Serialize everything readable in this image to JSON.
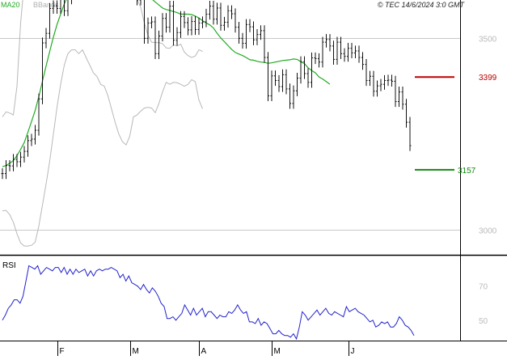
{
  "header": {
    "legend_ma20": "MA20",
    "legend_bbands": "BBands",
    "copyright": "© TEC 14/6/2024 3:0 GMT"
  },
  "colors": {
    "ma20": "#22aa22",
    "bbands": "#b8b8b8",
    "price": "#111111",
    "rsi": "#2222cc",
    "resistance": "#bb0000",
    "support": "#118811",
    "grid": "#c8c8c8"
  },
  "chart_data": [
    {
      "type": "line",
      "name": "price-panel",
      "title": "",
      "ylim": [
        2935,
        3600
      ],
      "y_ticks": [
        {
          "value": 3500,
          "label": "3500"
        },
        {
          "value": 3000,
          "label": "3000"
        }
      ],
      "grid": true,
      "resistance": {
        "value": 3399,
        "label": "3399"
      },
      "support": {
        "value": 3157,
        "label": "3157"
      },
      "ohlc_close": [
        3147,
        3168,
        3167,
        3184,
        3178,
        3190,
        3205,
        3233,
        3237,
        3260,
        3342,
        3488,
        3513,
        3578,
        3585,
        3578,
        3601,
        3572,
        3603,
        3614,
        3648,
        3677,
        3690,
        3690,
        3684,
        3720,
        3670,
        3699,
        3688,
        3660,
        3699,
        3700,
        3670,
        3630,
        3677,
        3646,
        3655,
        3600,
        3630,
        3500,
        3540,
        3543,
        3460,
        3506,
        3552,
        3529,
        3584,
        3495,
        3515,
        3557,
        3541,
        3522,
        3544,
        3523,
        3540,
        3543,
        3563,
        3584,
        3550,
        3579,
        3534,
        3542,
        3572,
        3564,
        3529,
        3500,
        3487,
        3536,
        3530,
        3496,
        3510,
        3520,
        3450,
        3350,
        3402,
        3390,
        3374,
        3405,
        3368,
        3330,
        3363,
        3396,
        3439,
        3408,
        3385,
        3449,
        3447,
        3438,
        3490,
        3497,
        3480,
        3445,
        3490,
        3460,
        3453,
        3474,
        3462,
        3467,
        3450,
        3432,
        3390,
        3401,
        3362,
        3376,
        3380,
        3390,
        3391,
        3388,
        3335,
        3360,
        3328,
        3281,
        3220
      ],
      "ma20": [
        3165,
        3168,
        3174,
        3181,
        3194,
        3210,
        3228,
        3255,
        3283,
        3312,
        3348,
        3388,
        3428,
        3466,
        3503,
        3536,
        3563,
        3590,
        3610,
        3627,
        3643,
        3657,
        3670,
        3679,
        3687,
        3693,
        3699,
        3700,
        3698,
        3696,
        3689,
        3683,
        3676,
        3671,
        3665,
        3660,
        3654,
        3645,
        3635,
        3625,
        3615,
        3603,
        3595,
        3587,
        3579,
        3575,
        3573,
        3570,
        3567,
        3563,
        3563,
        3563,
        3562,
        3558,
        3553,
        3546,
        3540,
        3535,
        3527,
        3513,
        3501,
        3491,
        3481,
        3471,
        3463,
        3459,
        3455,
        3450,
        3444,
        3443,
        3440,
        3438,
        3437,
        3435,
        3436,
        3438,
        3440,
        3442,
        3443,
        3444,
        3446,
        3445,
        3439,
        3434,
        3423,
        3416,
        3410,
        3399,
        3394,
        3387,
        3380
      ],
      "bband_upper": [
        3295,
        3308,
        3305,
        3300,
        3375,
        3540,
        3645,
        3660,
        3718,
        3729,
        3742,
        3755,
        3745,
        3722,
        3705,
        3690,
        3652,
        3670,
        3698,
        3697,
        3686,
        3670,
        3654,
        3643,
        3640,
        3670,
        3681,
        3680,
        3657,
        3647,
        3658,
        3680,
        3685,
        3700,
        3696,
        3676,
        3632,
        3602,
        3581,
        3540,
        3508,
        3490,
        3489,
        3489,
        3486,
        3475,
        3474,
        3483,
        3480,
        3485,
        3464,
        3455,
        3450,
        3454,
        3470,
        3466
      ],
      "bband_lower": [
        3050,
        3051,
        3040,
        3020,
        2990,
        2966,
        2958,
        2958,
        2960,
        2968,
        3010,
        3065,
        3120,
        3180,
        3250,
        3320,
        3380,
        3430,
        3460,
        3470,
        3470,
        3460,
        3470,
        3450,
        3430,
        3410,
        3400,
        3380,
        3375,
        3350,
        3315,
        3280,
        3250,
        3230,
        3222,
        3245,
        3295,
        3300,
        3310,
        3318,
        3320,
        3318,
        3306,
        3330,
        3360,
        3385,
        3380,
        3385,
        3384,
        3380,
        3375,
        3380,
        3392,
        3387,
        3339,
        3316
      ],
      "x_ticks": [
        {
          "label": "F",
          "index": 15
        },
        {
          "label": "M",
          "index": 35
        },
        {
          "label": "A",
          "index": 54
        },
        {
          "label": "M",
          "index": 74
        },
        {
          "label": "J",
          "index": 95
        }
      ]
    },
    {
      "type": "line",
      "name": "rsi-panel",
      "title": "RSI",
      "ylim": [
        38,
        87
      ],
      "y_ticks": [
        {
          "value": 70,
          "label": "70"
        },
        {
          "value": 50,
          "label": "50"
        }
      ],
      "series": [
        {
          "name": "RSI",
          "values": [
            50,
            53,
            57,
            59,
            62,
            62,
            60,
            64,
            73,
            82,
            81,
            80,
            82,
            77,
            79,
            81,
            80,
            79,
            81,
            81,
            78,
            81,
            77,
            80,
            77,
            80,
            78,
            79,
            80,
            76,
            79,
            76,
            79,
            80,
            79,
            80,
            80,
            81,
            80,
            79,
            75,
            77,
            73,
            76,
            72,
            71,
            70,
            68,
            71,
            68,
            66,
            69,
            67,
            64,
            60,
            58,
            51,
            51,
            52,
            50,
            52,
            54,
            59,
            56,
            53,
            57,
            53,
            55,
            57,
            52,
            55,
            55,
            53,
            51,
            53,
            52,
            52,
            55,
            54,
            56,
            59,
            56,
            54,
            55,
            49,
            49,
            48,
            51,
            47,
            49,
            48,
            45,
            42,
            42,
            44,
            42,
            41,
            41,
            40,
            42,
            39,
            46,
            55,
            53,
            50,
            52,
            54,
            56,
            53,
            55,
            57,
            54,
            53,
            55,
            54,
            53,
            52,
            58,
            55,
            56,
            57,
            55,
            54,
            53,
            51,
            49,
            50,
            46,
            47,
            49,
            48,
            49,
            46,
            46,
            48,
            52,
            50,
            47,
            46,
            44,
            41
          ]
        }
      ],
      "x_ticks": [
        {
          "label": "F",
          "index": 15
        },
        {
          "label": "M",
          "index": 35
        },
        {
          "label": "A",
          "index": 54
        },
        {
          "label": "M",
          "index": 74
        },
        {
          "label": "J",
          "index": 95
        }
      ]
    }
  ]
}
